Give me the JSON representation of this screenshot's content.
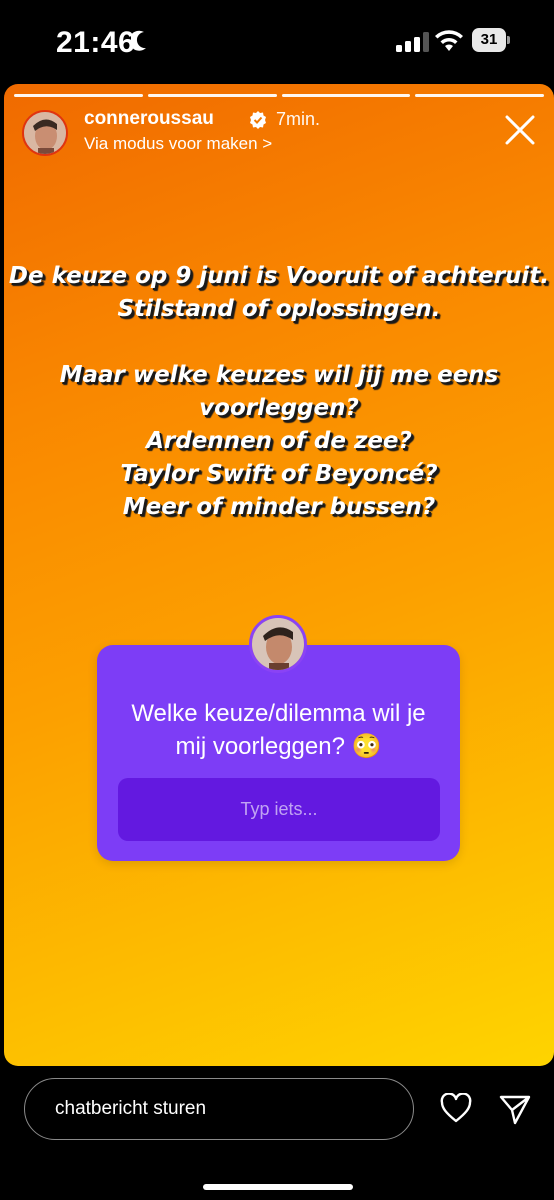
{
  "status_bar": {
    "time": "21:46",
    "battery_level": "31",
    "icons": [
      "moon-icon",
      "signal-icon",
      "wifi-icon",
      "battery-icon"
    ]
  },
  "story": {
    "segment_count": 4,
    "username": "conneroussau",
    "time_ago": "7min.",
    "subline": "Via modus voor maken >",
    "text_block1": [
      "De keuze op 9 juni is Vooruit of achteruit.",
      "Stilstand of oplossingen."
    ],
    "text_block2": [
      "Maar welke keuzes wil jij me eens",
      "voorleggen?",
      "Ardennen of de zee?",
      "Taylor Swift of Beyoncé?",
      "Meer of minder bussen?"
    ],
    "question": {
      "prompt": "Welke keuze/dilemma wil je mij voorleggen? 😳",
      "placeholder": "Typ iets..."
    },
    "colors": {
      "gradient_start": "#f06a00",
      "gradient_end": "#fed400",
      "sticker": "#7d3df6",
      "sticker_input": "#6319e0"
    }
  },
  "bottom_bar": {
    "chat_placeholder": "chatbericht sturen",
    "icons": [
      "heart-icon",
      "send-icon"
    ]
  }
}
